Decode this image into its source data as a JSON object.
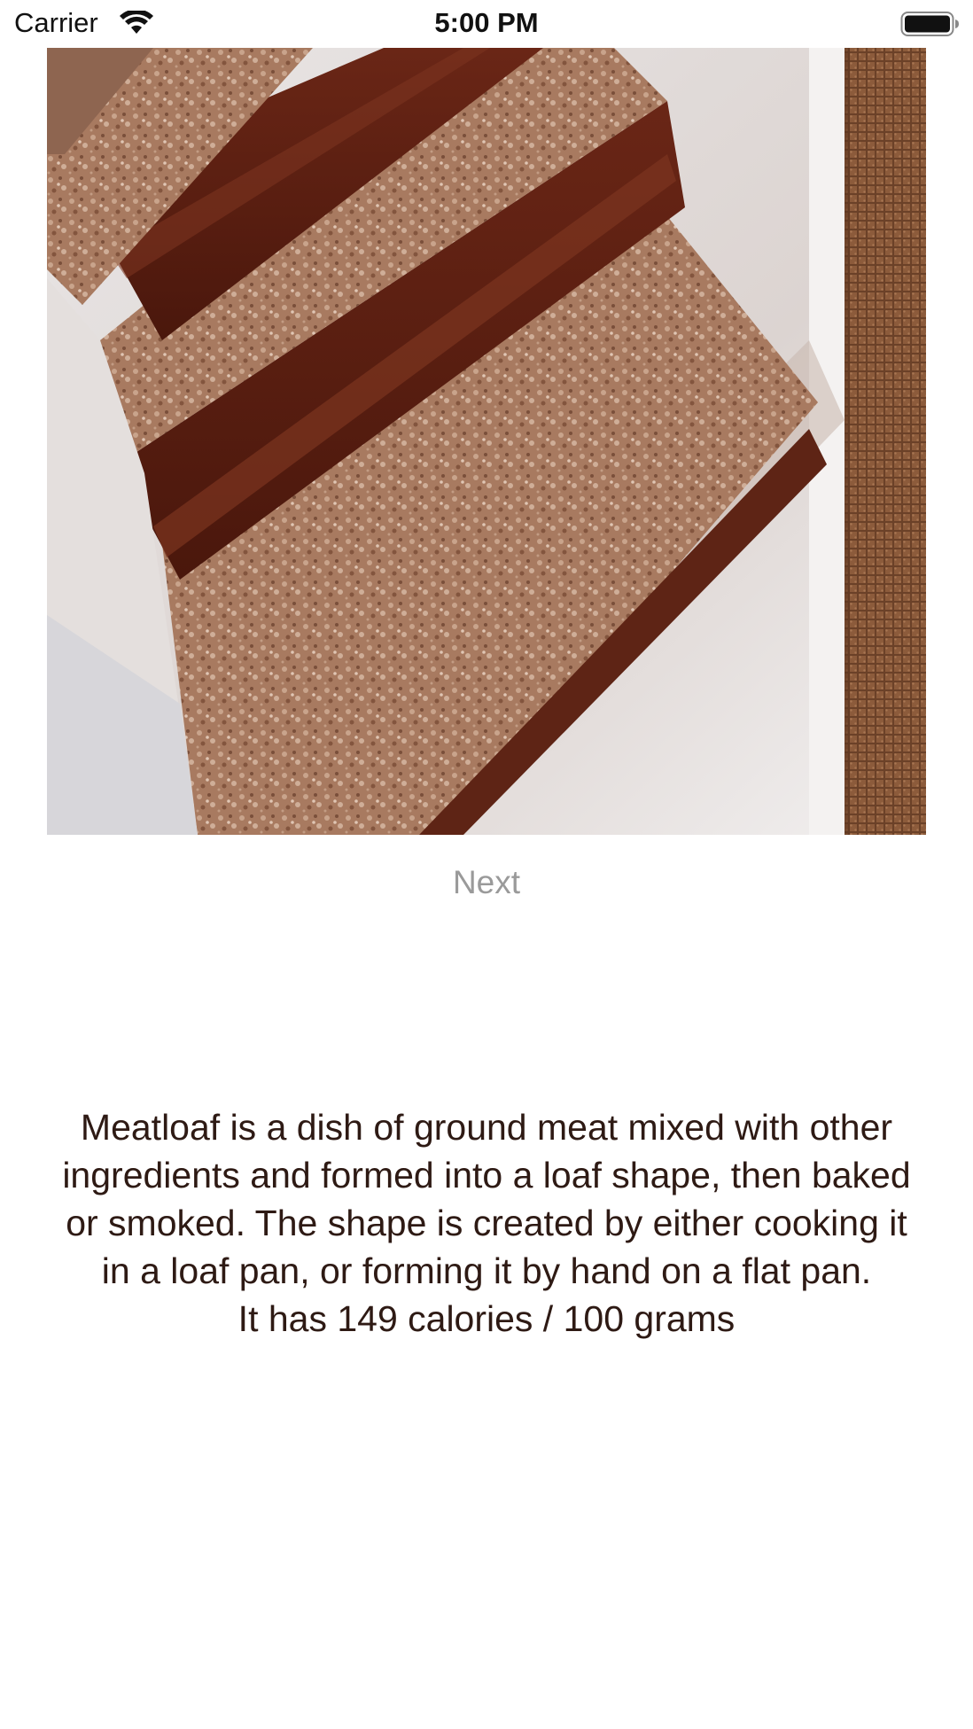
{
  "status_bar": {
    "carrier": "Carrier",
    "time": "5:00 PM",
    "wifi_icon": "wifi-icon",
    "battery_icon": "battery-icon"
  },
  "photo": {
    "icon": "meatloaf-photo"
  },
  "actions": {
    "next_label": "Next"
  },
  "description": {
    "text": "Meatloaf is a dish of ground meat mixed with other ingredients and formed into a loaf shape, then baked or smoked. The shape is created by either cooking it in a loaf pan, or forming it by hand on a flat pan.",
    "calories": "It has 149 calories / 100 grams"
  },
  "colors": {
    "text": "#2e1a14",
    "next": "#9a9a9a",
    "crust": "#5a1f12",
    "meat": "#a4775d",
    "plate": "#eae6e4",
    "burlap": "#8a5a3a"
  }
}
